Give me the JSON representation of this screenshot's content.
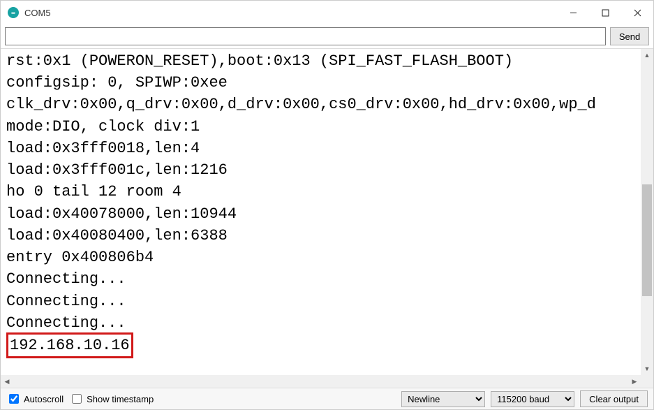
{
  "window": {
    "title": "COM5"
  },
  "input": {
    "value": "",
    "send_label": "Send"
  },
  "output_lines": [
    "rst:0x1 (POWERON_RESET),boot:0x13 (SPI_FAST_FLASH_BOOT)",
    "configsip: 0, SPIWP:0xee",
    "clk_drv:0x00,q_drv:0x00,d_drv:0x00,cs0_drv:0x00,hd_drv:0x00,wp_d",
    "mode:DIO, clock div:1",
    "load:0x3fff0018,len:4",
    "load:0x3fff001c,len:1216",
    "ho 0 tail 12 room 4",
    "load:0x40078000,len:10944",
    "load:0x40080400,len:6388",
    "entry 0x400806b4",
    "Connecting...",
    "Connecting...",
    "Connecting..."
  ],
  "highlighted_line": "192.168.10.16",
  "bottom": {
    "autoscroll_label": "Autoscroll",
    "autoscroll_checked": true,
    "show_timestamp_label": "Show timestamp",
    "show_timestamp_checked": false,
    "line_ending_label": "Newline",
    "baud_label": "115200 baud",
    "clear_label": "Clear output"
  }
}
